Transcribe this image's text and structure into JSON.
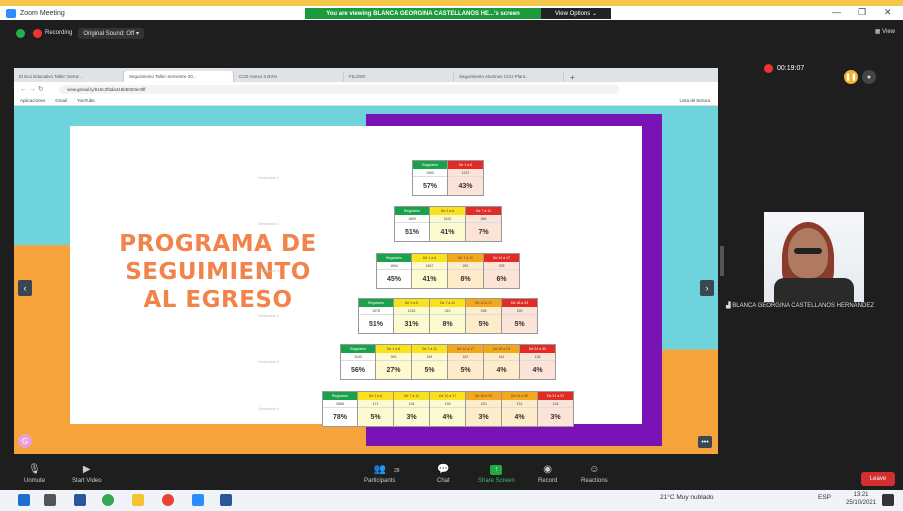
{
  "window": {
    "title": "Zoom Meeting",
    "share_banner": "You are viewing BLANCA GEORGINA CASTELLANOS HE...'s screen",
    "view_options": "View Options ⌄"
  },
  "recording": {
    "label": "Recording",
    "sound": "Original Sound: Off",
    "view": "View"
  },
  "browser": {
    "tabs": [
      "El Eco Educativo Taller 'cierra'...",
      "Seguimiento Taller Semestre 20...",
      "CCE Anexo II BVAI",
      "FILOSO",
      "Seguimiento Alumnos CCH Plant..."
    ],
    "url": "view.genial.ly/615c3f3da416b5003ec9ff",
    "bookmarks": [
      "Aplicaciones",
      "Gmail",
      "YouTube"
    ],
    "reading_list": "Lista de lectura"
  },
  "slide": {
    "title_lines": [
      "PROGRAMA DE",
      "SEGUIMIENTO",
      "AL EGRESO"
    ],
    "row_labels": [
      "Generación 1",
      "Generación 2",
      "Generación 3",
      "Generación 4",
      "Generación 5",
      "Generación 6"
    ],
    "rows": [
      [
        {
          "h": "Regulares",
          "n": "1960",
          "p": "57%",
          "c": "green"
        },
        {
          "h": "De 1 a 6",
          "n": "1237",
          "p": "43%",
          "c": "red"
        }
      ],
      [
        {
          "h": "Regulares",
          "n": "1869",
          "p": "51%",
          "c": "green"
        },
        {
          "h": "De 1 a 6",
          "n": "1522",
          "p": "41%",
          "c": "yellow"
        },
        {
          "h": "De 7 a 11",
          "n": "266",
          "p": "7%",
          "c": "red"
        }
      ],
      [
        {
          "h": "Regulares",
          "n": "1694",
          "p": "45%",
          "c": "green"
        },
        {
          "h": "De 1 a 6",
          "n": "1567",
          "p": "41%",
          "c": "yellow"
        },
        {
          "h": "De 7 a 11",
          "n": "291",
          "p": "8%",
          "c": "orange"
        },
        {
          "h": "De 12 a 17",
          "n": "228",
          "p": "6%",
          "c": "red"
        }
      ],
      [
        {
          "h": "Regulares",
          "n": "1978",
          "p": "51%",
          "c": "green"
        },
        {
          "h": "De 1 a 6",
          "n": "1215",
          "p": "31%",
          "c": "yellow"
        },
        {
          "h": "De 7 a 11",
          "n": "310",
          "p": "8%",
          "c": "yellow"
        },
        {
          "h": "De 12 a 17",
          "n": "198",
          "p": "5%",
          "c": "orange"
        },
        {
          "h": "De 18 a 23",
          "n": "190",
          "p": "5%",
          "c": "red"
        }
      ],
      [
        {
          "h": "Regulares",
          "n": "2040",
          "p": "56%",
          "c": "green"
        },
        {
          "h": "De 1 a 6",
          "n": "993",
          "p": "27%",
          "c": "yellow"
        },
        {
          "h": "De 7 a 11",
          "n": "184",
          "p": "5%",
          "c": "yellow"
        },
        {
          "h": "De 12 a 17",
          "n": "187",
          "p": "5%",
          "c": "orange"
        },
        {
          "h": "De 18 a 23",
          "n": "161",
          "p": "4%",
          "c": "orange"
        },
        {
          "h": "De 24 a 30",
          "n": "136",
          "p": "4%",
          "c": "red"
        }
      ],
      [
        {
          "h": "Regulares",
          "n": "2868",
          "p": "78%",
          "c": "green"
        },
        {
          "h": "De 1 a 6",
          "n": "171",
          "p": "5%",
          "c": "yellow"
        },
        {
          "h": "De 7 a 11",
          "n": "118",
          "p": "3%",
          "c": "yellow"
        },
        {
          "h": "De 12 a 17",
          "n": "135",
          "p": "4%",
          "c": "yellow"
        },
        {
          "h": "De 18 a 23",
          "n": "120",
          "p": "3%",
          "c": "orange"
        },
        {
          "h": "De 24 a 30",
          "n": "131",
          "p": "4%",
          "c": "orange"
        },
        {
          "h": "De 31 a 37",
          "n": "124",
          "p": "3%",
          "c": "red"
        }
      ]
    ],
    "badge": "G"
  },
  "meeting": {
    "timer": "00:19:07",
    "participant_name": "BLANCA GEORGINA CASTELLANOS HERNANDEZ"
  },
  "toolbar": {
    "unmute": "Unmute",
    "video": "Start Video",
    "participants": "Participants",
    "participants_count": "28",
    "chat": "Chat",
    "share": "Share Screen",
    "record": "Record",
    "reactions": "Reactions",
    "leave": "Leave"
  },
  "taskbar": {
    "weather": "21°C  Muy nublado",
    "lang": "ESP",
    "time": "13:21",
    "date": "25/10/2021"
  }
}
